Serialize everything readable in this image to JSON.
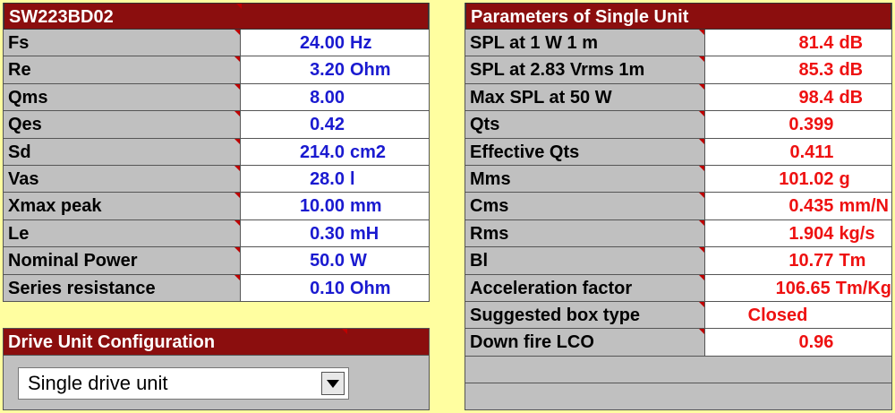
{
  "left": {
    "title": "SW223BD02",
    "rows": [
      {
        "label": "Fs",
        "value": "24.00",
        "unit": "Hz"
      },
      {
        "label": "Re",
        "value": "3.20",
        "unit": "Ohm"
      },
      {
        "label": "Qms",
        "value": "8.00",
        "unit": ""
      },
      {
        "label": "Qes",
        "value": "0.42",
        "unit": ""
      },
      {
        "label": "Sd",
        "value": "214.0",
        "unit": "cm2"
      },
      {
        "label": "Vas",
        "value": "28.0",
        "unit": "l"
      },
      {
        "label": "Xmax peak",
        "value": "10.00",
        "unit": "mm"
      },
      {
        "label": "Le",
        "value": "0.30",
        "unit": "mH"
      },
      {
        "label": "Nominal Power",
        "value": "50.0",
        "unit": "W"
      },
      {
        "label": "Series resistance",
        "value": "0.10",
        "unit": "Ohm"
      }
    ]
  },
  "config": {
    "title": "Drive Unit Configuration",
    "selected": "Single drive unit"
  },
  "right": {
    "title": "Parameters of Single Unit",
    "rows": [
      {
        "label": "SPL at 1 W 1 m",
        "value": "81.4",
        "unit": "dB"
      },
      {
        "label": "SPL at 2.83 Vrms 1m",
        "value": "85.3",
        "unit": "dB"
      },
      {
        "label": "Max SPL at 50 W",
        "value": "98.4",
        "unit": "dB"
      },
      {
        "label": "Qts",
        "value": "0.399",
        "unit": ""
      },
      {
        "label": "Effective Qts",
        "value": "0.411",
        "unit": ""
      },
      {
        "label": "Mms",
        "value": "101.02",
        "unit": "g"
      },
      {
        "label": "Cms",
        "value": "0.435",
        "unit": "mm/N"
      },
      {
        "label": "Rms",
        "value": "1.904",
        "unit": "kg/s"
      },
      {
        "label": "Bl",
        "value": "10.77",
        "unit": "Tm"
      },
      {
        "label": "Acceleration factor",
        "value": "106.65",
        "unit": "Tm/Kg"
      },
      {
        "label": "Suggested box type",
        "value": "Closed",
        "unit": ""
      },
      {
        "label": "Down fire LCO",
        "value": "0.96",
        "unit": ""
      }
    ]
  },
  "colors": {
    "background": "#fffea0",
    "header": "#8b0e0e",
    "input_value": "#1a1ad0",
    "computed_value": "#ee1111",
    "label_cell": "#c0c0c0"
  }
}
